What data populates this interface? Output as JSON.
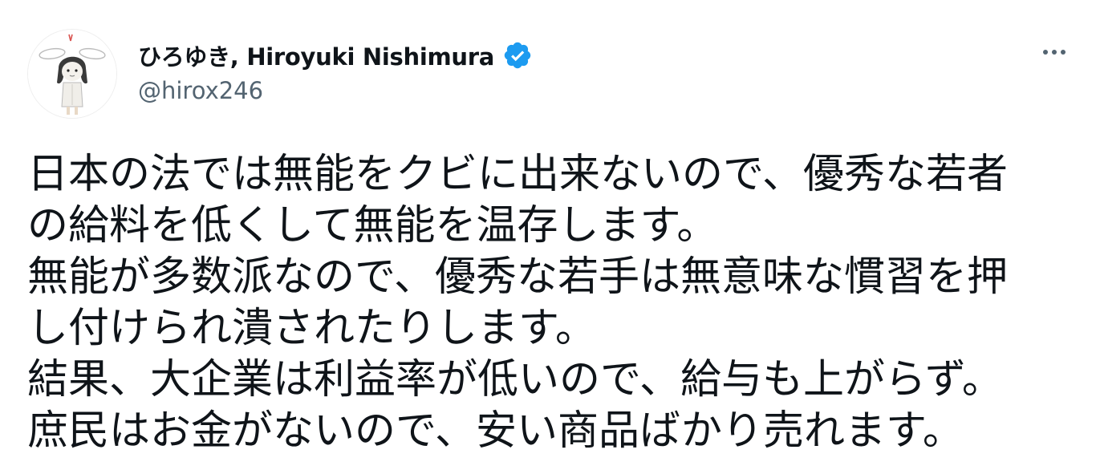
{
  "tweet": {
    "author": {
      "display_name": "ひろゆき, Hiroyuki Nishimura",
      "handle": "@hirox246",
      "verified": true,
      "avatar_icon": "avatar-illustration-icon"
    },
    "menu_icon": "more-options-icon",
    "text_lines": [
      "日本の法では無能をクビに出来ないので、優秀な若者",
      "の給料を低くして無能を温存します。",
      "無能が多数派なので、優秀な若手は無意味な慣習を押",
      "し付けられ潰されたりします。",
      "結果、大企業は利益率が低いので、給与も上がらず。",
      "庶民はお金がないので、安い商品ばかり売れます。"
    ]
  },
  "colors": {
    "text": "#0f1419",
    "secondary_text": "#536471",
    "verified_badge": "#1d9bf0",
    "background": "#ffffff"
  }
}
